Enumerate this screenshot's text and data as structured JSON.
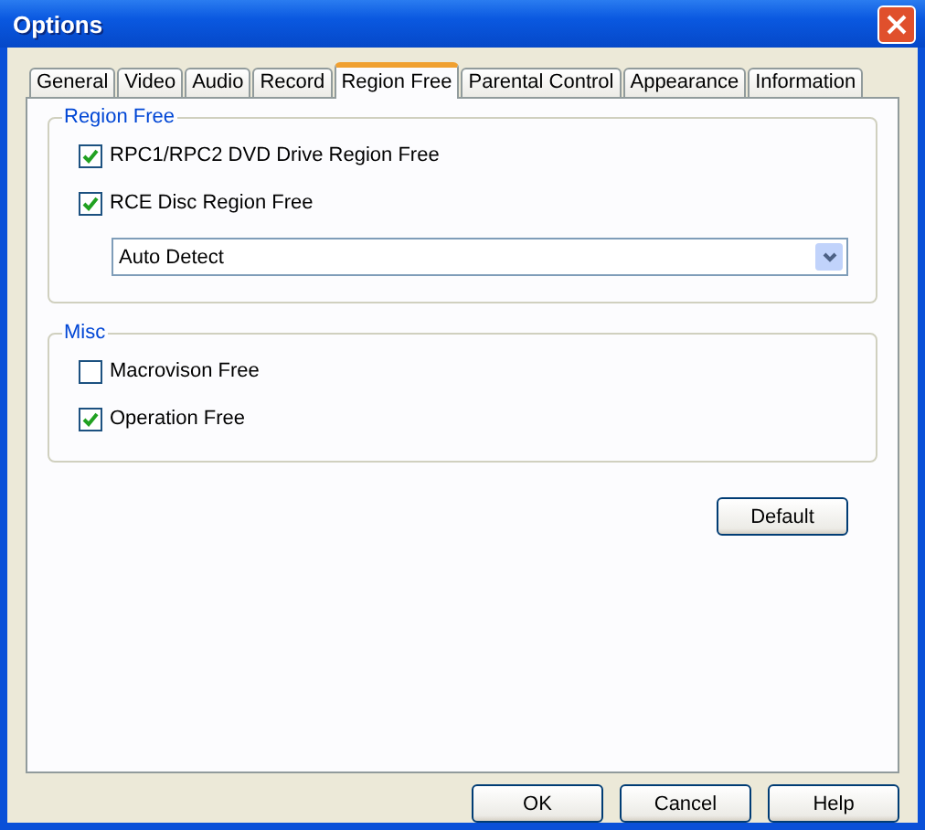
{
  "window": {
    "title": "Options"
  },
  "tabs": [
    {
      "label": "General",
      "selected": false
    },
    {
      "label": "Video",
      "selected": false
    },
    {
      "label": "Audio",
      "selected": false
    },
    {
      "label": "Record",
      "selected": false
    },
    {
      "label": "Region Free",
      "selected": true
    },
    {
      "label": "Parental Control",
      "selected": false
    },
    {
      "label": "Appearance",
      "selected": false
    },
    {
      "label": "Information",
      "selected": false
    }
  ],
  "groups": [
    {
      "title": "Region Free",
      "checkboxes": [
        {
          "label": "RPC1/RPC2 DVD Drive Region Free",
          "checked": true
        },
        {
          "label": "RCE Disc Region Free",
          "checked": true
        }
      ],
      "dropdown": {
        "value": "Auto Detect"
      }
    },
    {
      "title": "Misc",
      "checkboxes": [
        {
          "label": "Macrovison Free",
          "checked": false
        },
        {
          "label": "Operation Free",
          "checked": true
        }
      ]
    }
  ],
  "default_button": "Default",
  "buttons": [
    "OK",
    "Cancel",
    "Help"
  ]
}
